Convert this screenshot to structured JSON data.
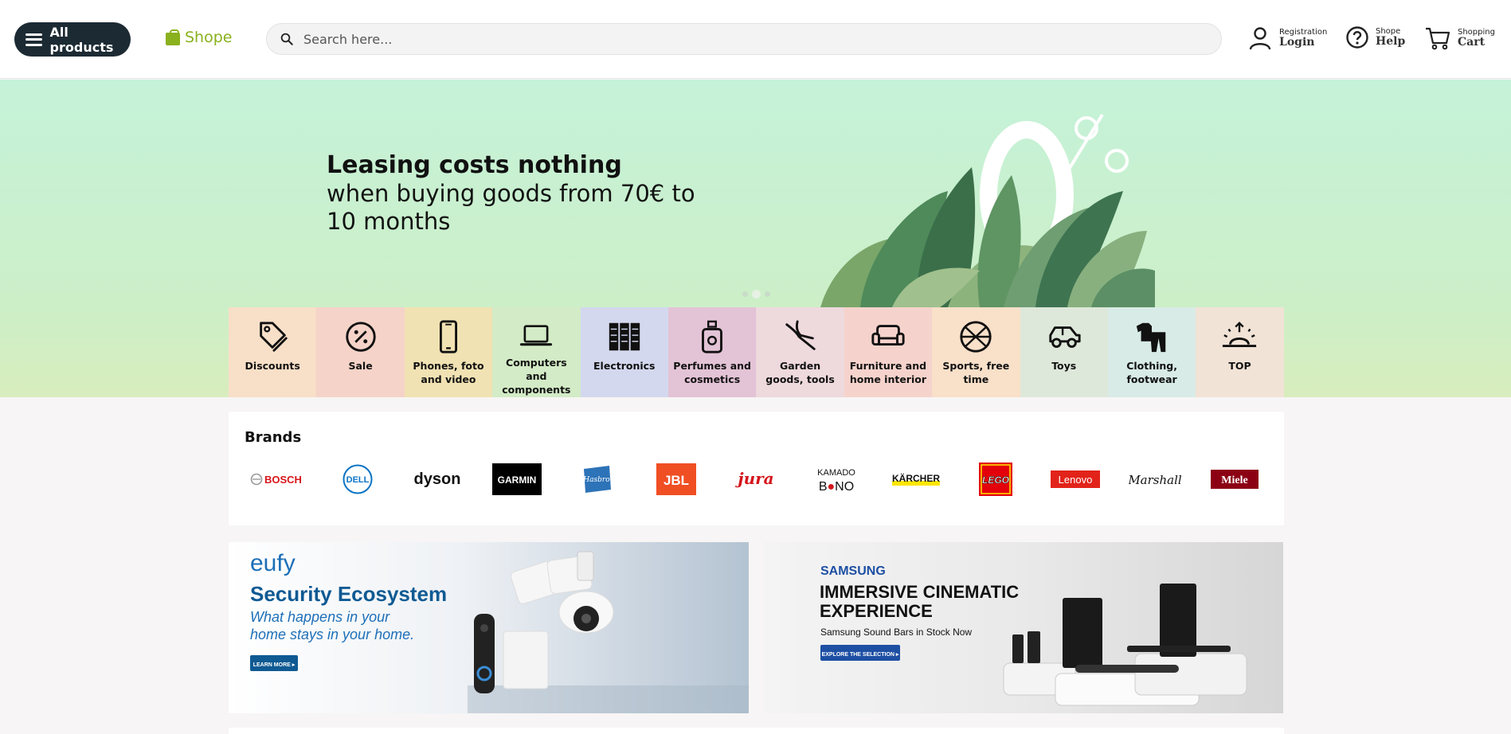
{
  "header": {
    "all_products": "All products",
    "logo": "Shope",
    "search_placeholder": "Search here...",
    "account": {
      "small": "Registration",
      "big": "Login"
    },
    "help": {
      "small": "Shope",
      "big": "Help"
    },
    "cart": {
      "small": "Shopping",
      "big": "Cart"
    },
    "colors": {
      "accent": "#8ab11e",
      "dark": "#1c2a33"
    }
  },
  "hero": {
    "title": "Leasing costs nothing",
    "subtitle": "when buying goods from 70€ to 10 months",
    "graphic_text": "0%",
    "slide_count": 3,
    "active_slide": 2
  },
  "categories": [
    {
      "label": "Discounts",
      "icon": "tag-icon",
      "color": "#f8dfc8"
    },
    {
      "label": "Sale",
      "icon": "percent-icon",
      "color": "#f5d3c8"
    },
    {
      "label": "Phones, foto and video",
      "icon": "phone-icon",
      "color": "#f1e2b3"
    },
    {
      "label": "Computers and components",
      "icon": "laptop-icon",
      "color": "#d3ebc6"
    },
    {
      "label": "Electronics",
      "icon": "server-icon",
      "color": "#d3d8ee"
    },
    {
      "label": "Perfumes and cosmetics",
      "icon": "perfume-icon",
      "color": "#e3c3d6"
    },
    {
      "label": "Garden goods, tools",
      "icon": "pruner-icon",
      "color": "#eed9dd"
    },
    {
      "label": "Furniture and home interior",
      "icon": "sofa-icon",
      "color": "#f5d3cc"
    },
    {
      "label": "Sports, free time",
      "icon": "basketball-icon",
      "color": "#f9e0c9"
    },
    {
      "label": "Toys",
      "icon": "toy-car-icon",
      "color": "#dee8da"
    },
    {
      "label": "Clothing, footwear",
      "icon": "clothing-icon",
      "color": "#d8ebe6"
    },
    {
      "label": "TOP",
      "icon": "sunrise-icon",
      "color": "#f1e3d6"
    }
  ],
  "brands": {
    "title": "Brands",
    "items": [
      "BOSCH",
      "DELL",
      "dyson",
      "GARMIN",
      "Hasbro",
      "JBL",
      "jura",
      "KAMADO BONO",
      "KÄRCHER",
      "LEGO",
      "Lenovo",
      "Marshall",
      "Miele"
    ]
  },
  "banners": {
    "eufy": {
      "brand": "eufy",
      "title": "Security Ecosystem",
      "tagline_1": "What happens in your",
      "tagline_2": "home stays in your home.",
      "cta": "LEARN MORE ▸"
    },
    "samsung": {
      "brand": "SAMSUNG",
      "title_1": "IMMERSIVE CINEMATIC",
      "title_2": "EXPERIENCE",
      "subtitle": "Samsung Sound Bars in Stock Now",
      "cta": "EXPLORE THE SELECTION ▸"
    }
  }
}
